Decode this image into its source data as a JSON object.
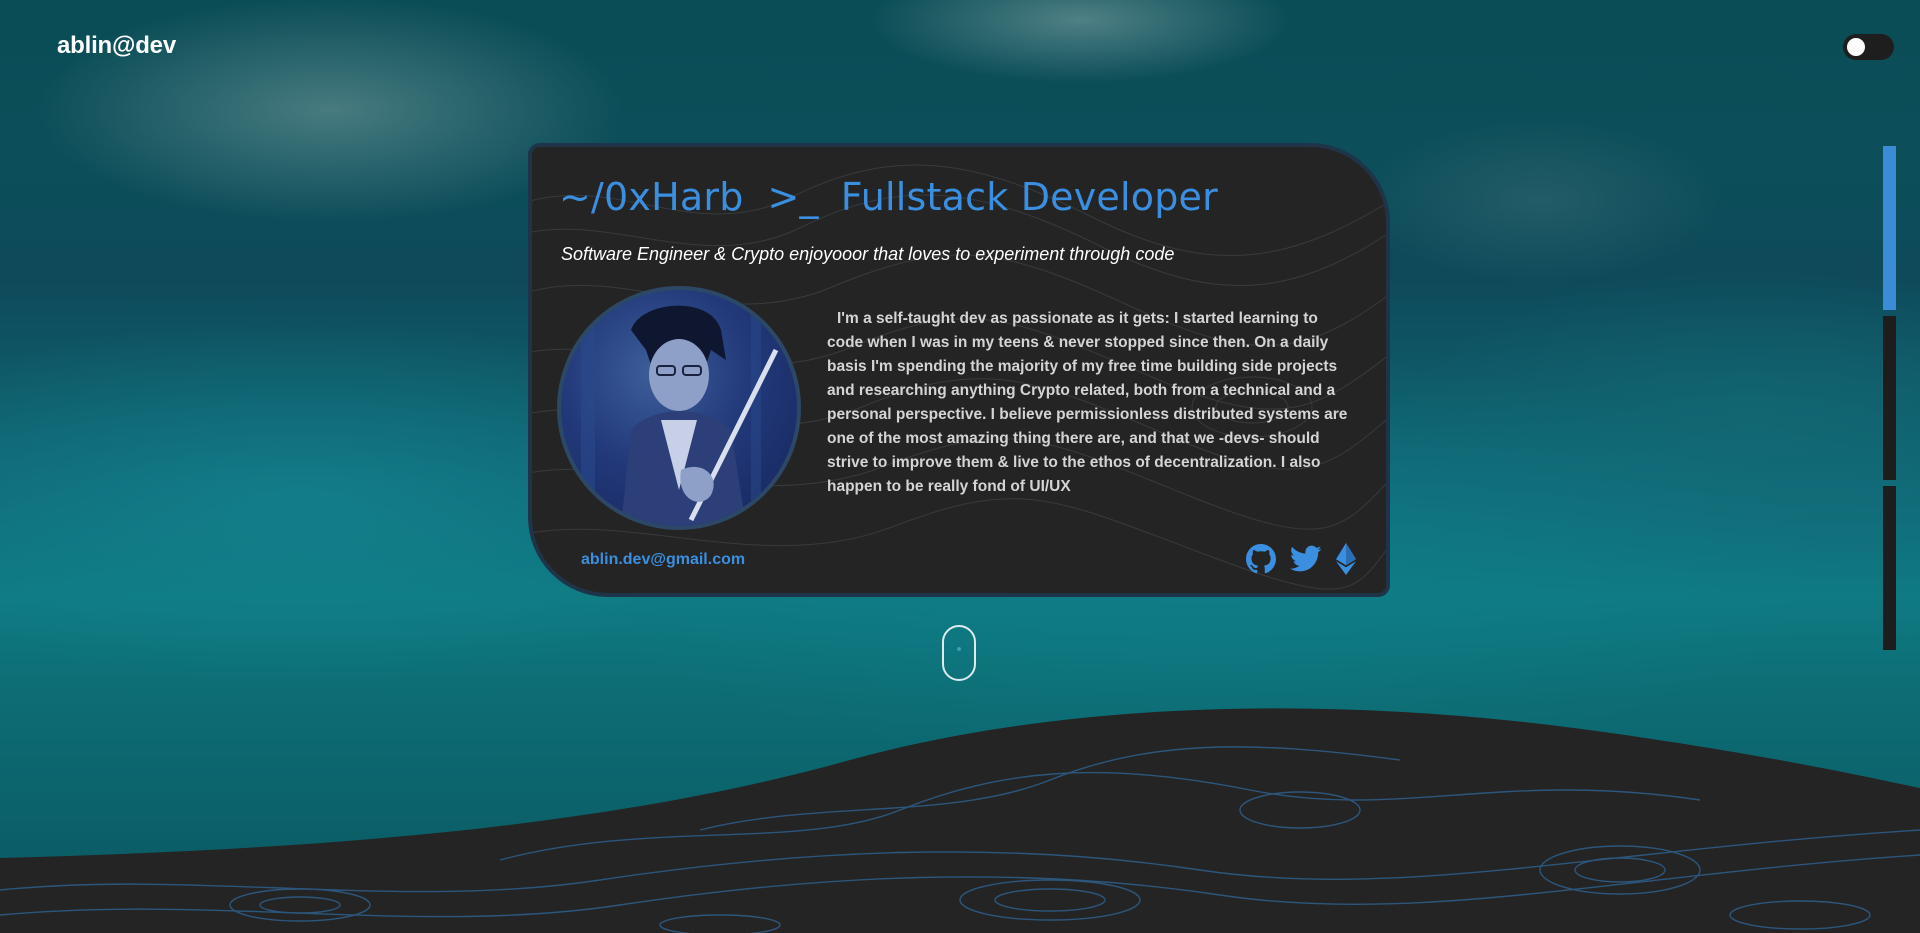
{
  "header": {
    "logo": "ablin@dev",
    "theme_toggle_state": "off"
  },
  "card": {
    "title_handle": "~/0xHarb",
    "title_prompt": ">_",
    "title_role": "Fullstack Developer",
    "subtitle": "Software Engineer & Crypto enjoyooor that loves to experiment through code",
    "bio": "I'm a self-taught dev as passionate as it gets: I started learning to code when I was in my teens & never stopped since then. On a daily basis I'm spending the majority of my free time building side projects and researching anything Crypto related, both from a technical and a personal perspective. I believe permissionless distributed systems are one of the most amazing thing there are, and that we -devs- should strive to improve them & live to the ethos of decentralization. I also happen to be really fond of UI/UX",
    "email": "ablin.dev@gmail.com",
    "socials": [
      {
        "icon": "github-icon"
      },
      {
        "icon": "twitter-icon"
      },
      {
        "icon": "ethereum-icon"
      }
    ]
  },
  "section_indicator": {
    "sections": 3,
    "active_index": 0
  },
  "colors": {
    "accent": "#3b8fe0",
    "card_bg": "#242424",
    "card_border": "#1f3448",
    "indicator_active": "#3b8bd6",
    "wave": "#242424",
    "wave_lines": "#2e5f8c"
  }
}
